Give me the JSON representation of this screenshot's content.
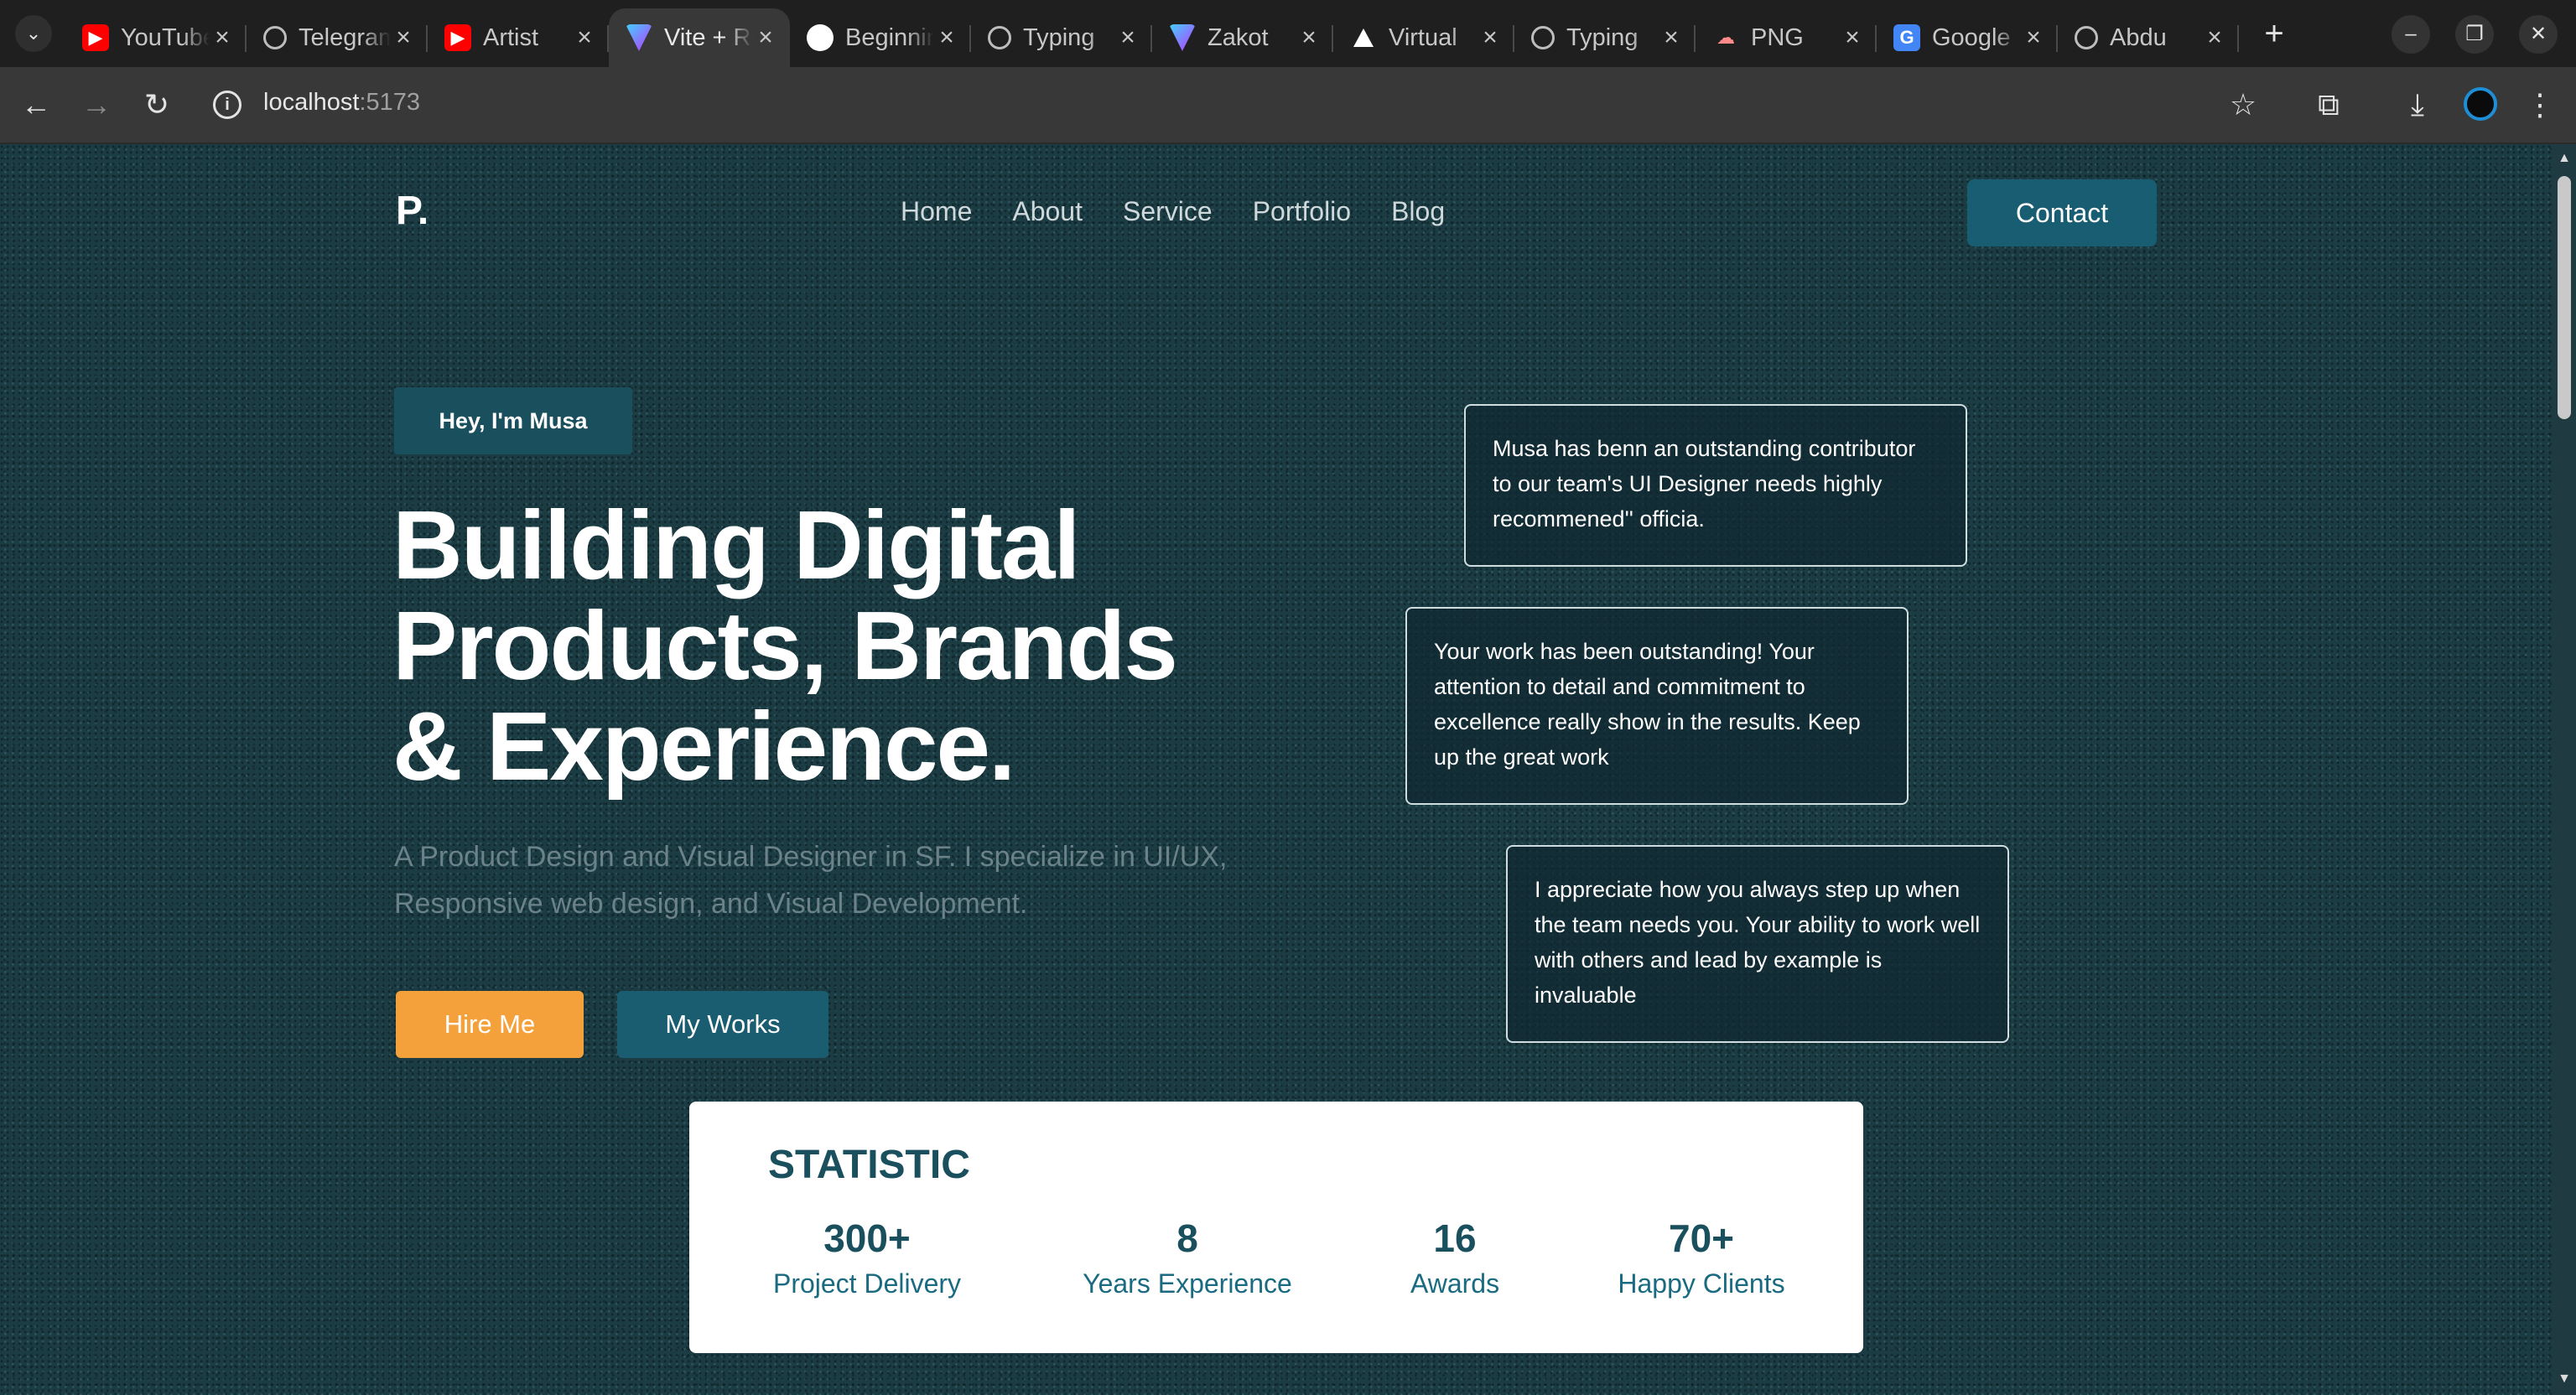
{
  "browser": {
    "tabs": [
      {
        "title": "YouTube",
        "icon": "youtube-icon",
        "active": false
      },
      {
        "title": "Telegram",
        "icon": "globe-icon",
        "active": false
      },
      {
        "title": "Artist",
        "icon": "youtube-icon",
        "active": false
      },
      {
        "title": "Vite + React",
        "icon": "vite-icon",
        "active": true
      },
      {
        "title": "Beginning",
        "icon": "github-icon",
        "active": false
      },
      {
        "title": "Typing",
        "icon": "globe-icon",
        "active": false
      },
      {
        "title": "Zakot",
        "icon": "vite-icon",
        "active": false
      },
      {
        "title": "Virtual",
        "icon": "triangle-icon",
        "active": false
      },
      {
        "title": "Typing",
        "icon": "globe-icon",
        "active": false
      },
      {
        "title": "PNG",
        "icon": "cloud-icon",
        "active": false
      },
      {
        "title": "Google",
        "icon": "translate-icon",
        "active": false
      },
      {
        "title": "Abdu",
        "icon": "globe-icon",
        "active": false
      }
    ],
    "close_glyph": "×",
    "url_host": "localhost",
    "url_port": ":5173"
  },
  "site": {
    "logo": "P.",
    "nav": [
      "Home",
      "About",
      "Service",
      "Portfolio",
      "Blog"
    ],
    "contact_label": "Contact"
  },
  "hero": {
    "badge": "Hey, I'm Musa",
    "headline": [
      "Building Digital",
      "Products, Brands",
      "& Experience."
    ],
    "description": "A Product Design and Visual Designer in SF. I specialize in UI/UX, Responsive web design, and Visual Development.",
    "hire_label": "Hire Me",
    "works_label": "My Works"
  },
  "testimonials": [
    "Musa has benn an outstanding contributor to our team's UI Designer needs highly recommened'' officia.",
    "Your work has been outstanding! Your attention to detail and commitment to excellence really show in the results. Keep up the great work",
    "I appreciate how you always step up when the team needs you. Your ability to work well with others and lead by example is invaluable"
  ],
  "statistic": {
    "title": "STATISTIC",
    "items": [
      {
        "value": "300+",
        "label": "Project Delivery"
      },
      {
        "value": "8",
        "label": "Years Experience"
      },
      {
        "value": "16",
        "label": "Awards"
      },
      {
        "value": "70+",
        "label": "Happy Clients"
      }
    ]
  },
  "colors": {
    "page_bg": "#1c3c44",
    "accent_teal": "#185d72",
    "accent_orange": "#f4a13b",
    "stat_text": "#1a4f5e"
  }
}
